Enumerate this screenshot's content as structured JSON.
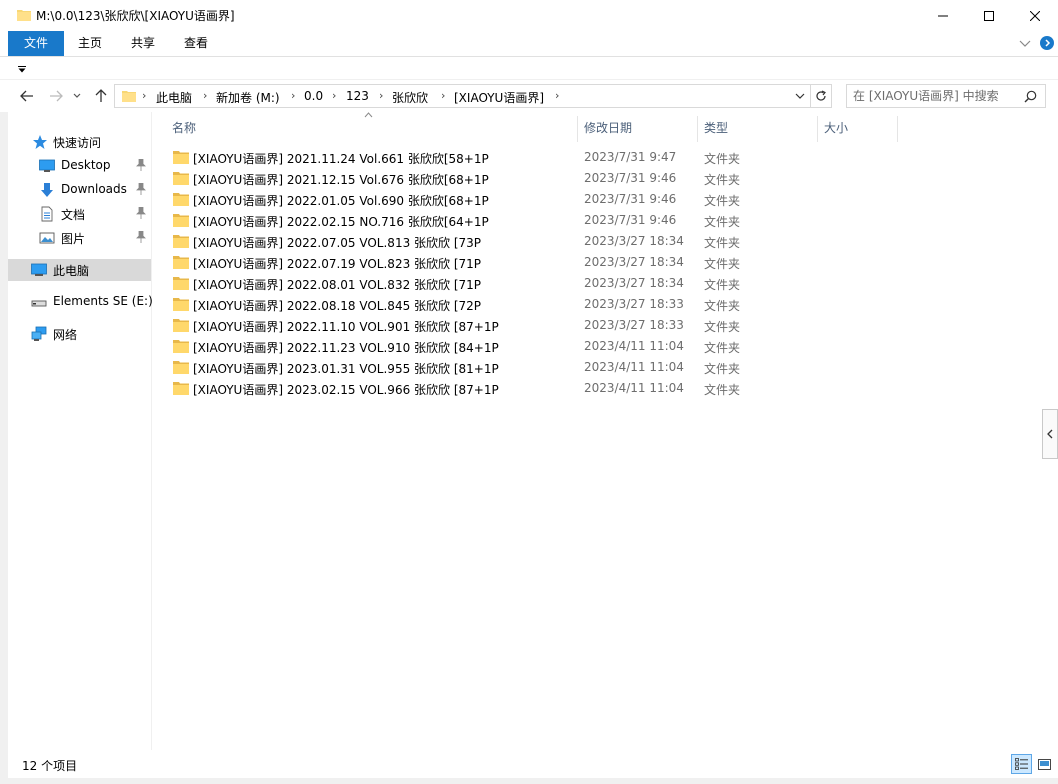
{
  "window": {
    "title": "M:\\0.0\\123\\张欣欣\\[XIAOYU语画界]",
    "accent": "#1979ca"
  },
  "ribbon": {
    "tabs": [
      {
        "label": "文件",
        "active": true
      },
      {
        "label": "主页",
        "active": false
      },
      {
        "label": "共享",
        "active": false
      },
      {
        "label": "查看",
        "active": false
      }
    ]
  },
  "address": {
    "crumbs": [
      "此电脑",
      "新加卷 (M:)",
      "0.0",
      "123",
      "张欣欣",
      "[XIAOYU语画界]"
    ]
  },
  "search": {
    "placeholder": "在 [XIAOYU语画界] 中搜索"
  },
  "sidebar": {
    "items": [
      {
        "label": "快速访问",
        "icon": "star-icon"
      },
      {
        "label": "Desktop",
        "icon": "desktop-icon",
        "pinned": true
      },
      {
        "label": "Downloads",
        "icon": "download-icon",
        "pinned": true
      },
      {
        "label": "文档",
        "icon": "document-icon",
        "pinned": true
      },
      {
        "label": "图片",
        "icon": "picture-icon",
        "pinned": true
      },
      {
        "label": "此电脑",
        "icon": "computer-icon"
      },
      {
        "label": "Elements SE (E:)",
        "icon": "drive-icon"
      },
      {
        "label": "网络",
        "icon": "network-icon"
      }
    ]
  },
  "columns": {
    "name": "名称",
    "date": "修改日期",
    "type": "类型",
    "size": "大小"
  },
  "files": [
    {
      "name": "[XIAOYU语画界] 2021.11.24 Vol.661 张欣欣[58+1P",
      "date": "2023/7/31 9:47",
      "type": "文件夹"
    },
    {
      "name": "[XIAOYU语画界] 2021.12.15 Vol.676 张欣欣[68+1P",
      "date": "2023/7/31 9:46",
      "type": "文件夹"
    },
    {
      "name": "[XIAOYU语画界] 2022.01.05 Vol.690 张欣欣[68+1P",
      "date": "2023/7/31 9:46",
      "type": "文件夹"
    },
    {
      "name": "[XIAOYU语画界] 2022.02.15 NO.716 张欣欣[64+1P",
      "date": "2023/7/31 9:46",
      "type": "文件夹"
    },
    {
      "name": "[XIAOYU语画界] 2022.07.05 VOL.813 张欣欣 [73P",
      "date": "2023/3/27 18:34",
      "type": "文件夹"
    },
    {
      "name": "[XIAOYU语画界] 2022.07.19 VOL.823 张欣欣 [71P",
      "date": "2023/3/27 18:34",
      "type": "文件夹"
    },
    {
      "name": "[XIAOYU语画界] 2022.08.01 VOL.832 张欣欣 [71P",
      "date": "2023/3/27 18:34",
      "type": "文件夹"
    },
    {
      "name": "[XIAOYU语画界] 2022.08.18 VOL.845 张欣欣 [72P",
      "date": "2023/3/27 18:33",
      "type": "文件夹"
    },
    {
      "name": "[XIAOYU语画界] 2022.11.10 VOL.901 张欣欣 [87+1P",
      "date": "2023/3/27 18:33",
      "type": "文件夹"
    },
    {
      "name": "[XIAOYU语画界] 2022.11.23 VOL.910 张欣欣 [84+1P",
      "date": "2023/4/11 11:04",
      "type": "文件夹"
    },
    {
      "name": "[XIAOYU语画界] 2023.01.31 VOL.955 张欣欣 [81+1P",
      "date": "2023/4/11 11:04",
      "type": "文件夹"
    },
    {
      "name": "[XIAOYU语画界] 2023.02.15 VOL.966 张欣欣 [87+1P",
      "date": "2023/4/11 11:04",
      "type": "文件夹"
    }
  ],
  "status": {
    "count": "12 个项目"
  }
}
